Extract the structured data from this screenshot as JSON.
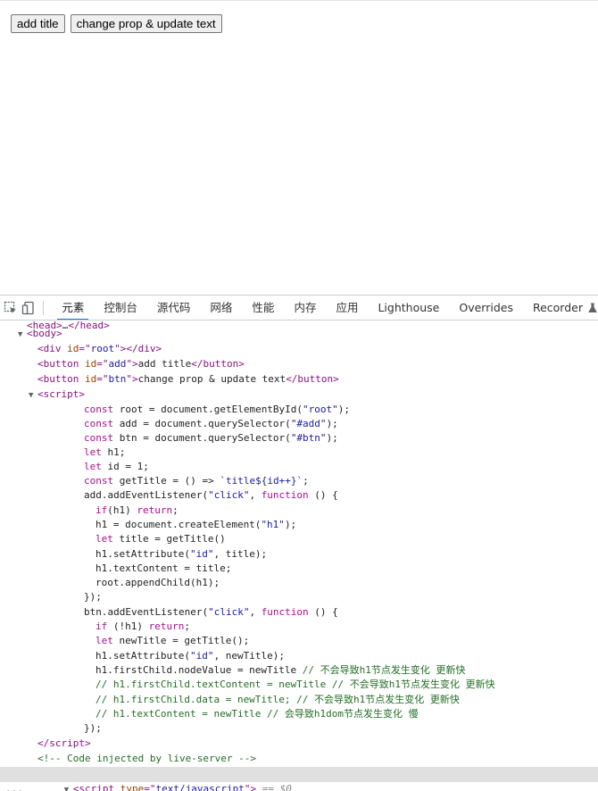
{
  "page": {
    "buttons": [
      {
        "name": "add-title-button",
        "label": "add title"
      },
      {
        "name": "change-prop-button",
        "label": "change prop & update text"
      }
    ]
  },
  "devtools": {
    "tabs": [
      {
        "name": "tab-elements",
        "label": "元素",
        "active": true
      },
      {
        "name": "tab-console",
        "label": "控制台"
      },
      {
        "name": "tab-sources",
        "label": "源代码"
      },
      {
        "name": "tab-network",
        "label": "网络"
      },
      {
        "name": "tab-performance",
        "label": "性能"
      },
      {
        "name": "tab-memory",
        "label": "内存"
      },
      {
        "name": "tab-application",
        "label": "应用"
      },
      {
        "name": "tab-lighthouse",
        "label": "Lighthouse"
      },
      {
        "name": "tab-overrides",
        "label": "Overrides"
      },
      {
        "name": "tab-recorder",
        "label": "Recorder"
      }
    ],
    "selected_suffix": "== $0",
    "dots": "..."
  }
}
